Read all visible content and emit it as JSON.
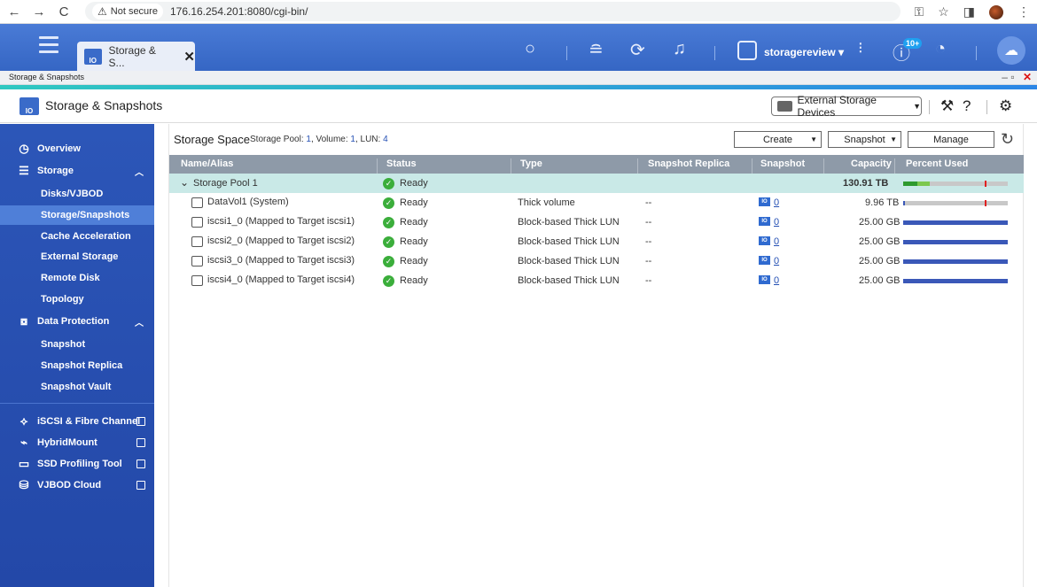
{
  "browser": {
    "back": "←",
    "forward": "→",
    "reload": "C",
    "security": "Not secure",
    "url": "176.16.254.201:8080/cgi-bin/",
    "right_icons": [
      "key-icon",
      "star-icon",
      "sidebar-icon",
      "avatar",
      "menu-icon"
    ]
  },
  "qts": {
    "tab_label": "Storage & S...",
    "tab_close": "✕",
    "user": "storagereview ▾",
    "notif_badge": "10+"
  },
  "window": {
    "title": "Storage & Snapshots",
    "minimize": "–",
    "restore": "▫",
    "close": "✕"
  },
  "app": {
    "icon_label": "IO",
    "title": "Storage & Snapshots",
    "external_button": "External Storage Devices"
  },
  "sidebar": {
    "overview": "Overview",
    "storage": "Storage",
    "storage_items": [
      "Disks/VJBOD",
      "Storage/Snapshots",
      "Cache Acceleration",
      "External Storage",
      "Remote Disk",
      "Topology"
    ],
    "data_protection": "Data Protection",
    "dp_items": [
      "Snapshot",
      "Snapshot Replica",
      "Snapshot Vault"
    ],
    "bottom": [
      "iSCSI & Fibre Channel",
      "HybridMount",
      "SSD Profiling Tool",
      "VJBOD Cloud"
    ]
  },
  "main": {
    "title": "Storage Space",
    "sub_pool_label": "Storage Pool: ",
    "sub_pool": "1",
    "sub_vol_label": ", Volume: ",
    "sub_vol": "1",
    "sub_lun_label": ", LUN: ",
    "sub_lun": "4",
    "btn_create": "Create",
    "btn_snapshot": "Snapshot",
    "btn_manage": "Manage",
    "columns": [
      "Name/Alias",
      "Status",
      "Type",
      "Snapshot Replica",
      "Snapshot",
      "Capacity",
      "Percent Used"
    ],
    "rows": [
      {
        "name": "Storage Pool 1",
        "status": "Ready",
        "type": "",
        "replica": "",
        "snapshot": "",
        "capacity": "130.91 TB",
        "used_pct": 25
      },
      {
        "name": "DataVol1 (System)",
        "status": "Ready",
        "type": "Thick volume",
        "replica": "--",
        "snapshot": "0",
        "capacity": "9.96 TB",
        "used_pct": 2
      },
      {
        "name": "iscsi1_0 (Mapped to Target iscsi1)",
        "status": "Ready",
        "type": "Block-based Thick LUN",
        "replica": "--",
        "snapshot": "0",
        "capacity": "25.00 GB",
        "used_pct": 100
      },
      {
        "name": "iscsi2_0 (Mapped to Target iscsi2)",
        "status": "Ready",
        "type": "Block-based Thick LUN",
        "replica": "--",
        "snapshot": "0",
        "capacity": "25.00 GB",
        "used_pct": 100
      },
      {
        "name": "iscsi3_0 (Mapped to Target iscsi3)",
        "status": "Ready",
        "type": "Block-based Thick LUN",
        "replica": "--",
        "snapshot": "0",
        "capacity": "25.00 GB",
        "used_pct": 100
      },
      {
        "name": "iscsi4_0 (Mapped to Target iscsi4)",
        "status": "Ready",
        "type": "Block-based Thick LUN",
        "replica": "--",
        "snapshot": "0",
        "capacity": "25.00 GB",
        "used_pct": 100
      }
    ]
  },
  "colors": {
    "accent": "#2c56b8",
    "ready": "#3bae3b",
    "pool_row": "#c9e9e7",
    "threshold": "#e02020"
  }
}
